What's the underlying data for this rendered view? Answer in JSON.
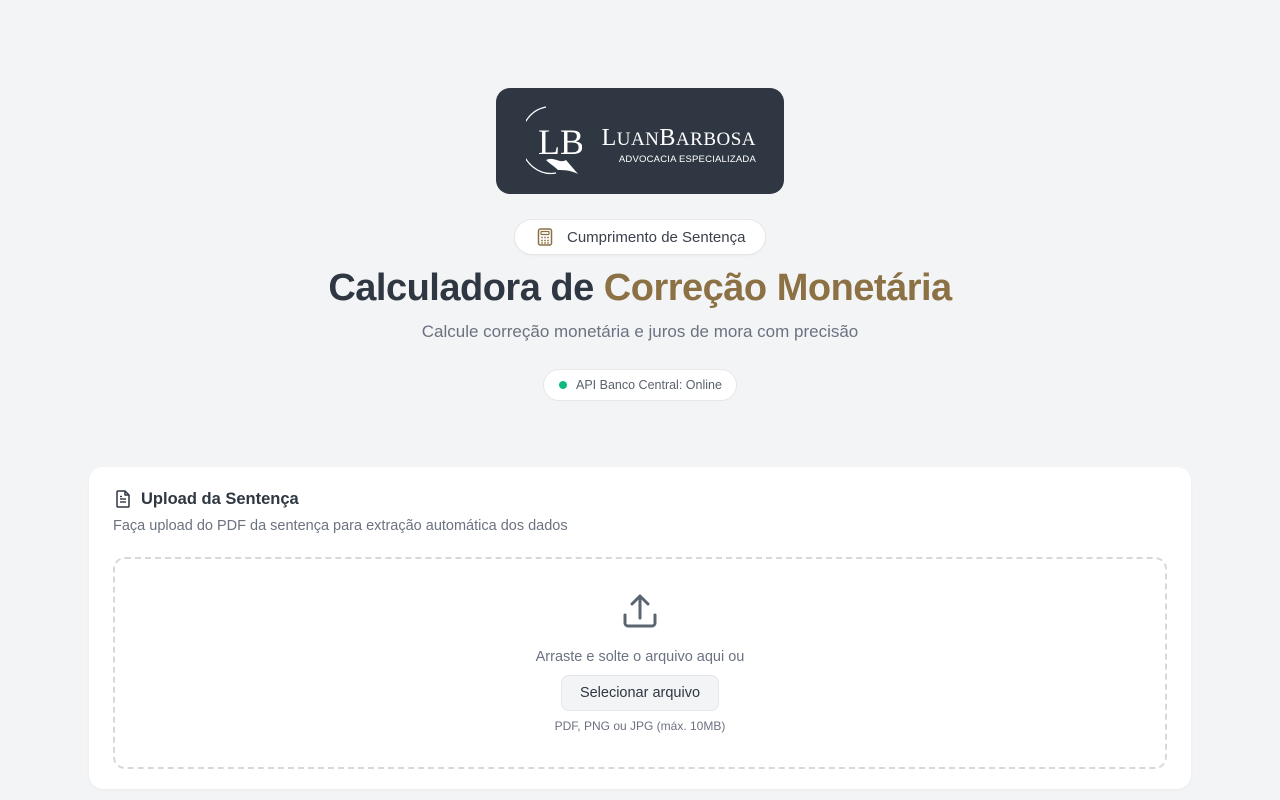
{
  "logo": {
    "monogram": "LB",
    "name_first_cap": "L",
    "name_first_rest": "UAN",
    "name_second_cap": "B",
    "name_second_rest": "ARBOSA",
    "tagline": "ADVOCACIA ESPECIALIZADA"
  },
  "header": {
    "category_label": "Cumprimento de Sentença",
    "title_main": "Calculadora de ",
    "title_accent": "Correção Monetária",
    "subtitle": "Calcule correção monetária e juros de mora com precisão",
    "api_status": "API Banco Central: Online"
  },
  "upload": {
    "title": "Upload da Sentença",
    "description": "Faça upload do PDF da sentença para extração automática dos dados",
    "drop_text": "Arraste e solte o arquivo aqui ou",
    "select_button": "Selecionar arquivo",
    "hint": "PDF, PNG ou JPG (máx. 10MB)"
  },
  "colors": {
    "accent": "#8c7145",
    "logo_background": "#2f3842",
    "status_online": "#10b981"
  },
  "icons": {
    "category": "calculator-icon",
    "card": "file-text-icon",
    "dropzone": "upload-icon"
  }
}
